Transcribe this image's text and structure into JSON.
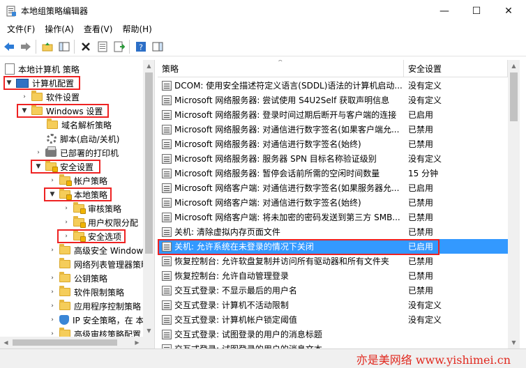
{
  "window": {
    "title": "本地组策略编辑器",
    "minimize": "—",
    "maximize": "☐",
    "close": "✕"
  },
  "menu": {
    "items": [
      "文件(F)",
      "操作(A)",
      "查看(V)",
      "帮助(H)"
    ]
  },
  "tree": {
    "root": "本地计算机 策略",
    "computer_config": "计算机配置",
    "software_settings": "软件设置",
    "windows_settings": "Windows 设置",
    "name_resolution": "域名解析策略",
    "scripts": "脚本(启动/关机)",
    "printers": "已部署的打印机",
    "security_settings": "安全设置",
    "account_policies": "帐户策略",
    "local_policies": "本地策略",
    "audit_policy": "审核策略",
    "user_rights": "用户权限分配",
    "security_options": "安全选项",
    "firewall": "高级安全 Window",
    "network_list": "网络列表管理器策略",
    "public_key": "公钥策略",
    "software_restriction": "软件限制策略",
    "app_control": "应用程序控制策略",
    "ip_security": "IP 安全策略，在 本",
    "advanced_audit": "高级审核策略配置"
  },
  "list": {
    "col_policy": "策略",
    "col_setting": "安全设置",
    "rows": [
      {
        "name": "DCOM: 使用安全描述符定义语言(SDDL)语法的计算机启动...",
        "setting": "没有定义"
      },
      {
        "name": "Microsoft 网络服务器: 尝试使用 S4U2Self 获取声明信息",
        "setting": "没有定义"
      },
      {
        "name": "Microsoft 网络服务器: 登录时间过期后断开与客户端的连接",
        "setting": "已启用"
      },
      {
        "name": "Microsoft 网络服务器: 对通信进行数字签名(如果客户端允...",
        "setting": "已禁用"
      },
      {
        "name": "Microsoft 网络服务器: 对通信进行数字签名(始终)",
        "setting": "已禁用"
      },
      {
        "name": "Microsoft 网络服务器: 服务器 SPN 目标名称验证级别",
        "setting": "没有定义"
      },
      {
        "name": "Microsoft 网络服务器: 暂停会话前所需的空闲时间数量",
        "setting": "15 分钟"
      },
      {
        "name": "Microsoft 网络客户端: 对通信进行数字签名(如果服务器允...",
        "setting": "已启用"
      },
      {
        "name": "Microsoft 网络客户端: 对通信进行数字签名(始终)",
        "setting": "已禁用"
      },
      {
        "name": "Microsoft 网络客户端: 将未加密的密码发送到第三方 SMB...",
        "setting": "已禁用"
      },
      {
        "name": "关机: 清除虚拟内存页面文件",
        "setting": "已禁用"
      },
      {
        "name": "关机: 允许系统在未登录的情况下关闭",
        "setting": "已启用"
      },
      {
        "name": "恢复控制台: 允许软盘复制并访问所有驱动器和所有文件夹",
        "setting": "已禁用"
      },
      {
        "name": "恢复控制台: 允许自动管理登录",
        "setting": "已禁用"
      },
      {
        "name": "交互式登录: 不显示最后的用户名",
        "setting": "已禁用"
      },
      {
        "name": "交互式登录: 计算机不活动限制",
        "setting": "没有定义"
      },
      {
        "name": "交互式登录: 计算机帐户锁定阈值",
        "setting": "没有定义"
      },
      {
        "name": "交互式登录: 试图登录的用户的消息标题",
        "setting": ""
      },
      {
        "name": "交互式登录: 试图登录的用户的消息文本",
        "setting": ""
      }
    ]
  },
  "watermark": "亦是美网络 www.yishimei.cn",
  "colors": {
    "selection": "#3399ff",
    "highlight_box": "#e22222"
  }
}
